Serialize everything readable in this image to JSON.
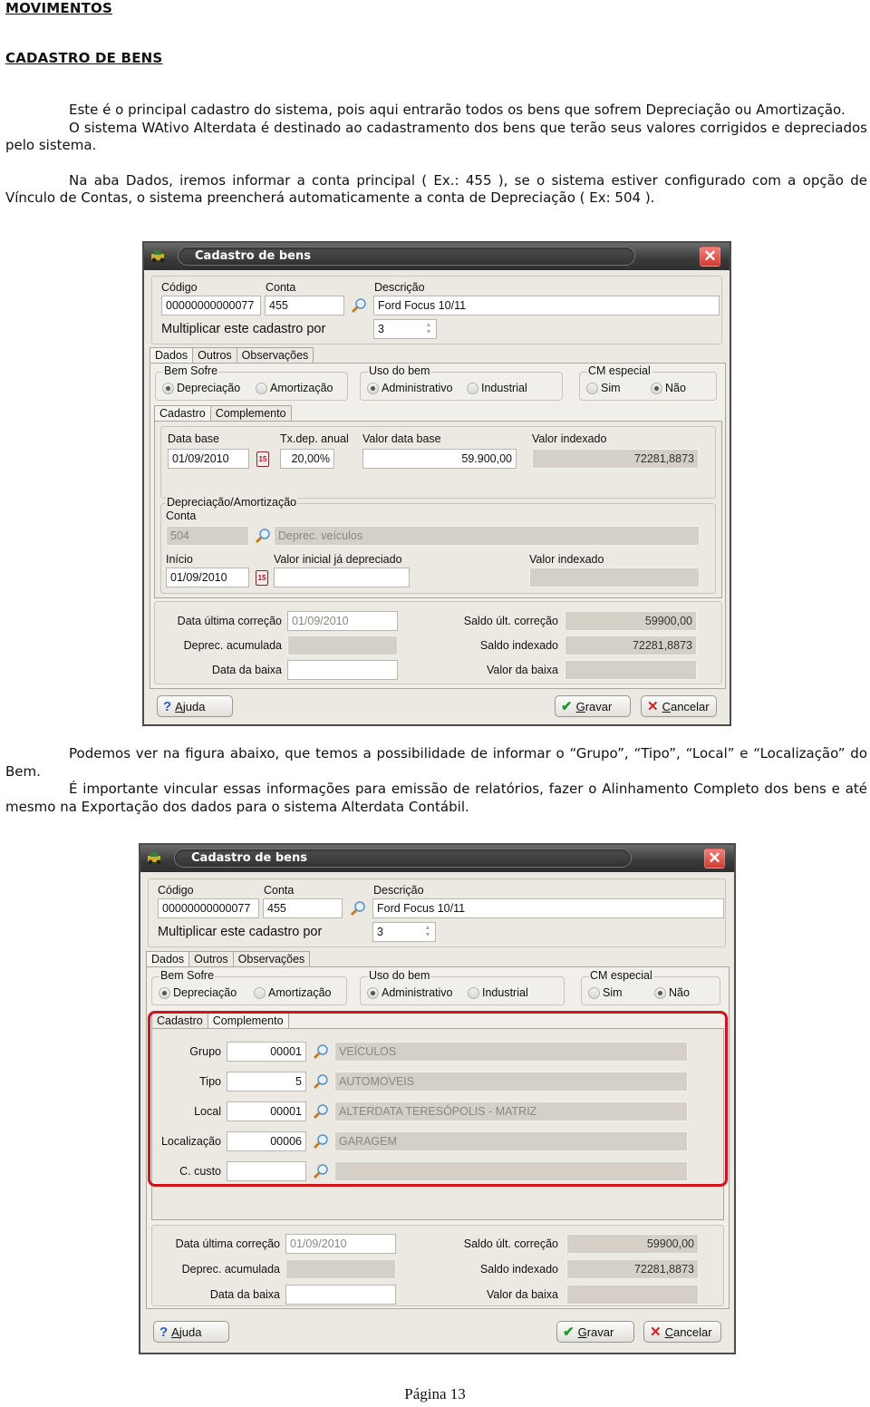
{
  "document": {
    "heading_1": "MOVIMENTOS",
    "heading_2": "CADASTRO DE BENS",
    "paragraphs_top": [
      "Este é o principal cadastro do sistema, pois aqui entrarão todos os bens que sofrem Depreciação ou Amortização.",
      "O sistema WAtivo Alterdata é destinado ao cadastramento dos bens que terão seus valores corrigidos e depreciados pelo sistema.",
      "Na aba Dados, iremos informar a conta principal ( Ex.: 455 ), se o sistema estiver configurado com a opção de Vínculo de Contas, o sistema preencherá automaticamente a conta de Depreciação ( Ex: 504 )."
    ],
    "paragraphs_middle": [
      "Podemos ver na figura abaixo, que temos a possibilidade de informar o “Grupo”, “Tipo”, “Local” e “Localização” do Bem.",
      "É importante vincular essas informações para emissão de relatórios, fazer o Alinhamento Completo dos bens e até mesmo na Exportação dos dados para o sistema Alterdata Contábil."
    ],
    "footer": "Página 13"
  },
  "window_common": {
    "title": "Cadastro de bens",
    "close_glyph": "✕",
    "codigo_label": "Código",
    "codigo_value": "00000000000077",
    "conta_label": "Conta",
    "conta_value": "455",
    "descricao_label": "Descrição",
    "descricao_value": "Ford Focus 10/11",
    "multiplicar_label": "Multiplicar este cadastro por",
    "multiplicar_value": "3",
    "main_tabs": [
      "Dados",
      "Outros",
      "Observações"
    ],
    "bem_sofre": {
      "title": "Bem Sofre",
      "options": [
        "Depreciação",
        "Amortização"
      ],
      "selected": "Depreciação"
    },
    "uso_do_bem": {
      "title": "Uso do bem",
      "options": [
        "Administrativo",
        "Industrial"
      ],
      "selected": "Administrativo"
    },
    "cm_especial": {
      "title": "CM especial",
      "options": [
        "Sim",
        "Não"
      ],
      "selected": "Não"
    },
    "sub_tabs": [
      "Cadastro",
      "Complemento"
    ],
    "summary": {
      "data_ultima_correcao_label": "Data última correção",
      "data_ultima_correcao_value": "01/09/2010",
      "deprec_acumulada_label": "Deprec. acumulada",
      "deprec_acumulada_value": "",
      "data_baixa_label": "Data da baixa",
      "data_baixa_value": "",
      "saldo_ult_correcao_label": "Saldo últ. correção",
      "saldo_ult_correcao_value": "59900,00",
      "saldo_indexado_label": "Saldo indexado",
      "saldo_indexado_value": "72281,8873",
      "valor_baixa_label": "Valor da baixa",
      "valor_baixa_value": ""
    },
    "buttons": {
      "ajuda": "Ajuda",
      "gravar": "Gravar",
      "cancelar": "Cancelar"
    }
  },
  "window1_cadastro_tab": {
    "data_base_label": "Data base",
    "data_base_value": "01/09/2010",
    "calendar_icon_text": "15",
    "tx_dep_label": "Tx.dep. anual",
    "tx_dep_value": "20,00%",
    "valor_data_base_label": "Valor data base",
    "valor_data_base_value": "59.900,00",
    "valor_indexado_label": "Valor indexado",
    "valor_indexado_value": "72281,8873",
    "dep_group_title": "Depreciação/Amortização",
    "dep_conta_label": "Conta",
    "dep_conta_value": "504",
    "dep_conta_desc": "Deprec. veículos",
    "inicio_label": "Início",
    "inicio_value": "01/09/2010",
    "valor_inicial_label": "Valor inicial já depreciado",
    "valor_inicial_value": "",
    "dep_valor_indexado_label": "Valor indexado",
    "dep_valor_indexado_value": ""
  },
  "window2_complemento_tab": {
    "rows": [
      {
        "label": "Grupo",
        "code": "00001",
        "desc": "VEÍCULOS"
      },
      {
        "label": "Tipo",
        "code": "5",
        "desc": "AUTOMOVEIS"
      },
      {
        "label": "Local",
        "code": "00001",
        "desc": "ALTERDATA TERESÓPOLIS - MATRIZ"
      },
      {
        "label": "Localização",
        "code": "00006",
        "desc": "GARAGEM"
      },
      {
        "label": "C. custo",
        "code": "",
        "desc": ""
      }
    ],
    "highlight_color": "#d0141c"
  }
}
